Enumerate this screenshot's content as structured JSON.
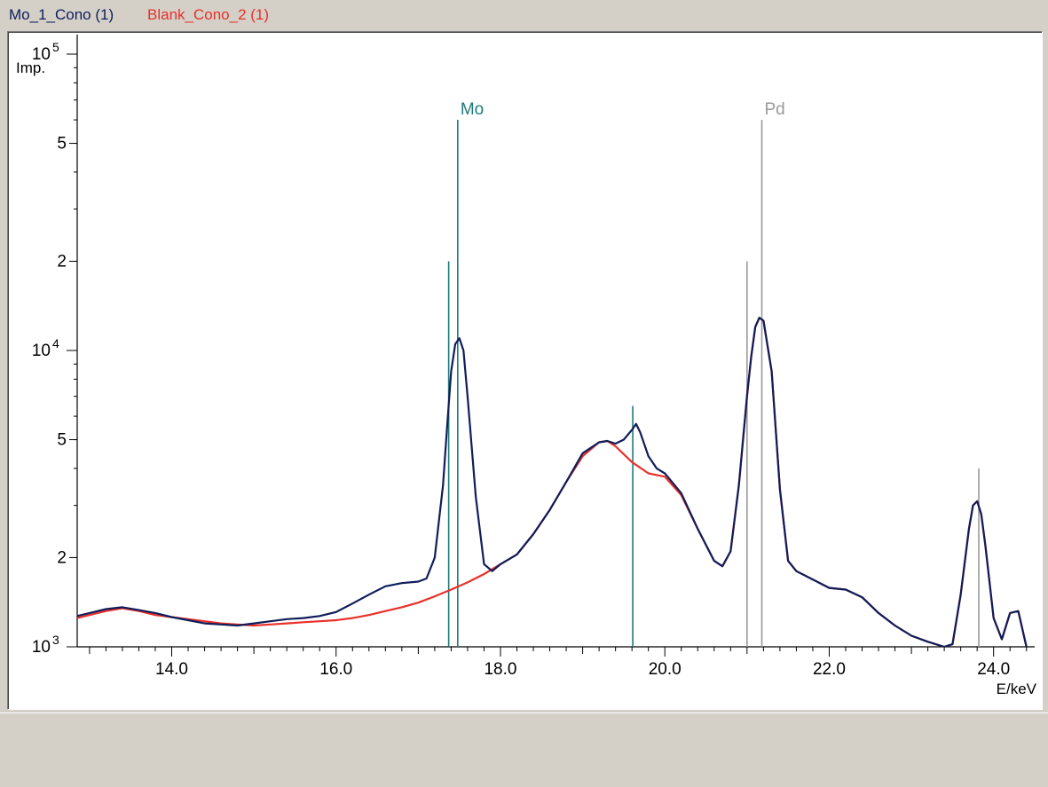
{
  "legend": {
    "entries": [
      {
        "label": "Mo_1_Cono (1)",
        "color": "#0f1d5a"
      },
      {
        "label": "Blank_Cono_2 (1)",
        "color": "#e8302a"
      }
    ]
  },
  "chart_data": {
    "type": "line",
    "title": "",
    "xlabel": "E/keV",
    "ylabel": "Imp.",
    "yscale": "log",
    "xlim": [
      12.85,
      24.5
    ],
    "ylim": [
      1000,
      100000
    ],
    "x_ticks": [
      14.0,
      16.0,
      18.0,
      20.0,
      22.0,
      24.0
    ],
    "x_tick_labels": [
      "14.0",
      "16.0",
      "18.0",
      "20.0",
      "22.0",
      "24.0"
    ],
    "y_ticks": [
      {
        "value": 1000,
        "base": "10",
        "exp": "3"
      },
      {
        "value": 2000,
        "base": "2",
        "exp": ""
      },
      {
        "value": 5000,
        "base": "5",
        "exp": ""
      },
      {
        "value": 10000,
        "base": "10",
        "exp": "4"
      },
      {
        "value": 20000,
        "base": "2",
        "exp": ""
      },
      {
        "value": 50000,
        "base": "5",
        "exp": ""
      },
      {
        "value": 100000,
        "base": "10",
        "exp": "5"
      }
    ],
    "grid": false,
    "series": [
      {
        "name": "Mo_1_Cono (1)",
        "color": "#0f1d5a",
        "x": [
          12.85,
          13.0,
          13.2,
          13.4,
          13.6,
          13.8,
          14.0,
          14.2,
          14.4,
          14.6,
          14.8,
          15.0,
          15.2,
          15.4,
          15.6,
          15.8,
          16.0,
          16.2,
          16.4,
          16.6,
          16.8,
          17.0,
          17.1,
          17.2,
          17.3,
          17.35,
          17.4,
          17.45,
          17.5,
          17.55,
          17.6,
          17.7,
          17.8,
          17.9,
          18.0,
          18.2,
          18.4,
          18.6,
          18.8,
          19.0,
          19.2,
          19.3,
          19.4,
          19.5,
          19.6,
          19.65,
          19.7,
          19.8,
          19.9,
          20.0,
          20.2,
          20.4,
          20.6,
          20.7,
          20.8,
          20.9,
          21.0,
          21.05,
          21.1,
          21.15,
          21.2,
          21.3,
          21.4,
          21.5,
          21.6,
          22.0,
          22.2,
          22.4,
          22.6,
          22.8,
          23.0,
          23.2,
          23.4,
          23.5,
          23.6,
          23.7,
          23.75,
          23.8,
          23.85,
          23.9,
          24.0,
          24.1,
          24.2,
          24.3,
          24.4,
          24.5
        ],
        "y": [
          1270,
          1300,
          1340,
          1360,
          1330,
          1300,
          1260,
          1230,
          1200,
          1190,
          1180,
          1200,
          1220,
          1240,
          1250,
          1270,
          1310,
          1400,
          1500,
          1600,
          1640,
          1660,
          1700,
          2000,
          3500,
          5500,
          8500,
          10500,
          11000,
          10000,
          7000,
          3200,
          1900,
          1800,
          1900,
          2050,
          2400,
          2900,
          3600,
          4500,
          4900,
          4950,
          4850,
          5000,
          5400,
          5650,
          5300,
          4400,
          4000,
          3850,
          3300,
          2500,
          1950,
          1870,
          2100,
          3500,
          7000,
          9500,
          12000,
          12900,
          12600,
          8500,
          3400,
          1950,
          1800,
          1580,
          1560,
          1470,
          1300,
          1180,
          1090,
          1040,
          1000,
          1020,
          1500,
          2500,
          3000,
          3100,
          2800,
          2200,
          1250,
          1060,
          1300,
          1320,
          1000,
          880
        ]
      },
      {
        "name": "Blank_Cono_2 (1)",
        "color": "#e8302a",
        "x": [
          12.85,
          13.0,
          13.2,
          13.4,
          13.6,
          13.8,
          14.0,
          14.2,
          14.4,
          14.6,
          14.8,
          15.0,
          15.2,
          15.4,
          15.6,
          15.8,
          16.0,
          16.2,
          16.4,
          16.6,
          16.8,
          17.0,
          17.2,
          17.4,
          17.6,
          17.8,
          18.0,
          18.2,
          18.4,
          18.6,
          18.8,
          19.0,
          19.2,
          19.3,
          19.4,
          19.6,
          19.8,
          20.0,
          20.2,
          20.4,
          20.6,
          20.7,
          20.8,
          20.9,
          21.0,
          21.05,
          21.1,
          21.15,
          21.2,
          21.3,
          21.4,
          21.5,
          21.6,
          22.0,
          22.2,
          22.4,
          22.6,
          22.8,
          23.0,
          23.2,
          23.4,
          23.5,
          23.6,
          23.7,
          23.75,
          23.8,
          23.85,
          23.9,
          24.0,
          24.1,
          24.2,
          24.3,
          24.4,
          24.5
        ],
        "y": [
          1250,
          1280,
          1320,
          1350,
          1320,
          1280,
          1260,
          1240,
          1220,
          1200,
          1190,
          1180,
          1190,
          1200,
          1210,
          1220,
          1230,
          1250,
          1280,
          1320,
          1360,
          1410,
          1480,
          1560,
          1650,
          1760,
          1900,
          2050,
          2400,
          2900,
          3600,
          4400,
          4900,
          4950,
          4750,
          4200,
          3850,
          3750,
          3250,
          2500,
          1950,
          1870,
          2100,
          3500,
          7000,
          9500,
          12000,
          12900,
          12600,
          8500,
          3400,
          1950,
          1800,
          1580,
          1560,
          1470,
          1300,
          1180,
          1090,
          1040,
          1000,
          1020,
          1500,
          2500,
          3000,
          3100,
          2800,
          2200,
          1250,
          1060,
          1300,
          1320,
          1000,
          880
        ]
      }
    ],
    "markers": [
      {
        "element": "Mo",
        "label": "Mo",
        "color": "#1f7a7a",
        "lines": [
          {
            "x": 17.37,
            "height": 20000
          },
          {
            "x": 17.48,
            "height": 60000
          },
          {
            "x": 19.61,
            "height": 6500
          }
        ]
      },
      {
        "element": "Pd",
        "label": "Pd",
        "color": "#9a9a9a",
        "lines": [
          {
            "x": 21.0,
            "height": 20000
          },
          {
            "x": 21.18,
            "height": 60000
          },
          {
            "x": 23.82,
            "height": 4000
          }
        ]
      }
    ]
  }
}
